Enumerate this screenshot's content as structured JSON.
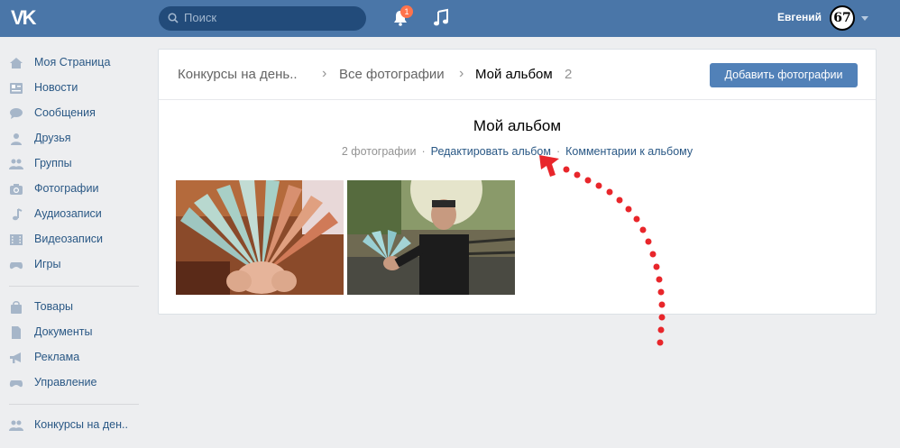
{
  "header": {
    "logo_text": "VK",
    "search_placeholder": "Поиск",
    "notifications_count": "1",
    "user_name": "Евгений",
    "avatar_text": "67"
  },
  "sidebar": {
    "items": [
      {
        "label": "Моя Страница",
        "icon": "home-icon"
      },
      {
        "label": "Новости",
        "icon": "news-icon"
      },
      {
        "label": "Сообщения",
        "icon": "messages-icon"
      },
      {
        "label": "Друзья",
        "icon": "friends-icon"
      },
      {
        "label": "Группы",
        "icon": "groups-icon"
      },
      {
        "label": "Фотографии",
        "icon": "camera-icon"
      },
      {
        "label": "Аудиозаписи",
        "icon": "music-note-icon"
      },
      {
        "label": "Видеозаписи",
        "icon": "film-icon"
      },
      {
        "label": "Игры",
        "icon": "gamepad-icon"
      },
      {
        "label": "Товары",
        "icon": "shopping-bag-icon"
      },
      {
        "label": "Документы",
        "icon": "document-icon"
      },
      {
        "label": "Реклама",
        "icon": "megaphone-icon"
      },
      {
        "label": "Управление",
        "icon": "gamepad-icon"
      },
      {
        "label": "Конкурсы на ден..",
        "icon": "groups-icon"
      }
    ]
  },
  "breadcrumb": {
    "level1": "Конкурсы на день..",
    "level2": "Все фотографии",
    "current": "Мой альбом",
    "count": "2"
  },
  "actions": {
    "add_photos": "Добавить фотографии"
  },
  "album": {
    "title": "Мой альбом",
    "photo_count": "2 фотографии",
    "edit_link": "Редактировать альбом",
    "comments_link": "Комментарии к альбому"
  },
  "colors": {
    "header": "#4a76a8",
    "link": "#2a5885",
    "button": "#5181b8",
    "annotation_arrow": "#e8262b"
  }
}
